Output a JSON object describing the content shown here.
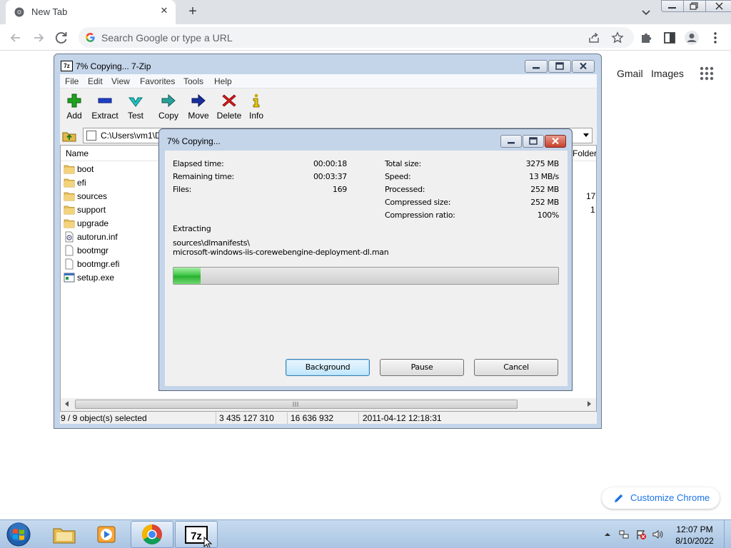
{
  "chrome": {
    "tab_title": "New Tab",
    "new_tab_symbol": "+",
    "close_symbol": "✕",
    "omnibox_placeholder": "Search Google or type a URL"
  },
  "ntp": {
    "gmail": "Gmail",
    "images": "Images",
    "customize": "Customize Chrome"
  },
  "zip": {
    "title": "7% Copying... 7-Zip",
    "title_icon": "7z",
    "menu": [
      "File",
      "Edit",
      "View",
      "Favorites",
      "Tools",
      "Help"
    ],
    "toolbar": [
      "Add",
      "Extract",
      "Test",
      "Copy",
      "Move",
      "Delete",
      "Info"
    ],
    "address": "C:\\Users\\vm1\\D",
    "columns": {
      "name": "Name",
      "folders": "Folder"
    },
    "files": [
      {
        "name": "boot",
        "type": "folder"
      },
      {
        "name": "efi",
        "type": "folder"
      },
      {
        "name": "sources",
        "type": "folder"
      },
      {
        "name": "support",
        "type": "folder"
      },
      {
        "name": "upgrade",
        "type": "folder"
      },
      {
        "name": "autorun.inf",
        "type": "inf"
      },
      {
        "name": "bootmgr",
        "type": "file"
      },
      {
        "name": "bootmgr.efi",
        "type": "file"
      },
      {
        "name": "setup.exe",
        "type": "exe"
      }
    ],
    "side_values": [
      "17",
      "1"
    ],
    "status": {
      "selected": "9 / 9 object(s) selected",
      "size": "3 435 127 310",
      "packed": "16 636 932",
      "modified": "2011-04-12 12:18:31"
    }
  },
  "progress": {
    "title": "7% Copying...",
    "elapsed_label": "Elapsed time:",
    "elapsed": "00:00:18",
    "remaining_label": "Remaining time:",
    "remaining": "00:03:37",
    "files_label": "Files:",
    "files": "169",
    "total_label": "Total size:",
    "total": "3275 MB",
    "speed_label": "Speed:",
    "speed": "13 MB/s",
    "processed_label": "Processed:",
    "processed": "252 MB",
    "compressed_label": "Compressed size:",
    "compressed": "252 MB",
    "ratio_label": "Compression ratio:",
    "ratio": "100%",
    "operation": "Extracting",
    "path_line1": "sources\\dlmanifests\\",
    "path_line2": "microsoft-windows-iis-corewebengine-deployment-dl.man",
    "percent": 7,
    "buttons": {
      "background": "Background",
      "pause": "Pause",
      "cancel": "Cancel"
    }
  },
  "taskbar": {
    "time": "12:07 PM",
    "date": "8/10/2022",
    "apps": [
      "explorer-icon",
      "media-player-icon",
      "chrome-icon",
      "7zip-icon"
    ]
  },
  "colors": {
    "chrome_tabbar": "#dee1e6",
    "chrome_link": "#1a73e8",
    "win7_frame": "#c4d5ea",
    "progress_green": "#37c23f"
  }
}
